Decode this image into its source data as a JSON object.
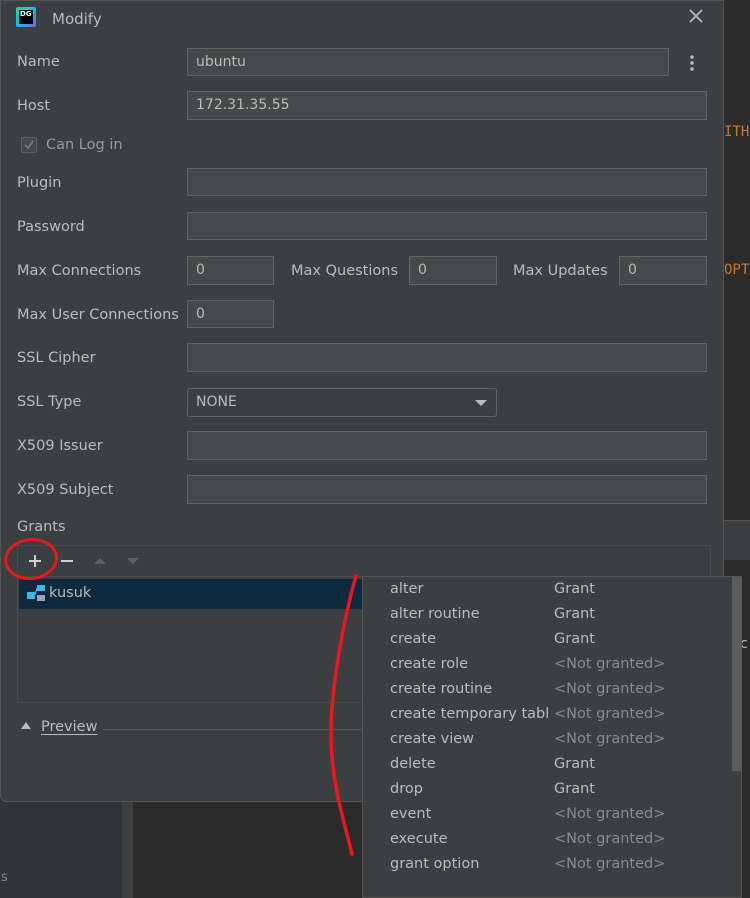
{
  "dialog": {
    "title": "Modify",
    "app_icon_text": "DG"
  },
  "form": {
    "name_label": "Name",
    "name_value": "ubuntu",
    "host_label": "Host",
    "host_value": "172.31.35.55",
    "can_log_in_label": "Can Log in",
    "plugin_label": "Plugin",
    "plugin_value": "",
    "password_label": "Password",
    "password_value": "",
    "max_connections_label": "Max Connections",
    "max_connections_value": "0",
    "max_questions_label": "Max Questions",
    "max_questions_value": "0",
    "max_updates_label": "Max Updates",
    "max_updates_value": "0",
    "max_user_connections_label": "Max User Connections",
    "max_user_connections_value": "0",
    "ssl_cipher_label": "SSL Cipher",
    "ssl_cipher_value": "",
    "ssl_type_label": "SSL Type",
    "ssl_type_value": "NONE",
    "x509_issuer_label": "X509 Issuer",
    "x509_issuer_value": "",
    "x509_subject_label": "X509 Subject",
    "x509_subject_value": ""
  },
  "grants": {
    "label": "Grants",
    "items": [
      {
        "name": "kusuk"
      }
    ]
  },
  "preview": {
    "label": "Preview"
  },
  "privileges": [
    {
      "name": "alter",
      "value": "Grant"
    },
    {
      "name": "alter routine",
      "value": "Grant"
    },
    {
      "name": "create",
      "value": "Grant"
    },
    {
      "name": "create role",
      "value": "<Not granted>"
    },
    {
      "name": "create routine",
      "value": "<Not granted>"
    },
    {
      "name": "create temporary tables",
      "value": "<Not granted>"
    },
    {
      "name": "create view",
      "value": "<Not granted>"
    },
    {
      "name": "delete",
      "value": "Grant"
    },
    {
      "name": "drop",
      "value": "Grant"
    },
    {
      "name": "event",
      "value": "<Not granted>"
    },
    {
      "name": "execute",
      "value": "<Not granted>"
    },
    {
      "name": "grant option",
      "value": "<Not granted>"
    }
  ],
  "background": {
    "code_fragment_1": "ITH",
    "code_fragment_2": "OPT",
    "side_char": "c",
    "strip_char": "s"
  },
  "colors": {
    "dialog_bg": "#3c3f41",
    "field_bg": "#45494a",
    "selection_bg": "#0d293e",
    "annotation_red": "#e8181e",
    "keyword_orange": "#cc7832"
  }
}
